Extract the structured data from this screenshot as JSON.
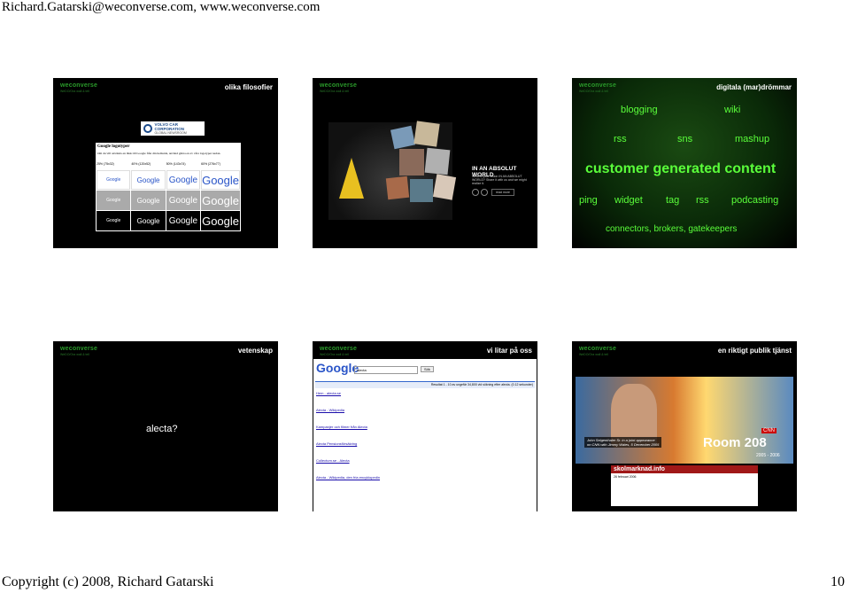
{
  "header": {
    "text": "Richard.Gatarski@weconverse.com, www.weconverse.com"
  },
  "footer": {
    "copyright": "Copyright (c) 2008, Richard Gatarski",
    "page_number": "10"
  },
  "brand": {
    "logo": "weconverse",
    "tagline": "WeDO/Ora wall & tell"
  },
  "slides": [
    {
      "title": "olika filosofier",
      "volvo_logo": "VOLVO CAR CORPORATION",
      "volvo_sub": "GLOBAL NEWSROOM",
      "google_heading": "Google logotyper",
      "google_text": "Om du vill använda en länk till Google från din hemsida, använd gärna en av våra logotyper nedan.",
      "sizes": [
        "25% (75x32)",
        "40% (120x52)",
        "50% (143x74)",
        "60% (276x77)"
      ],
      "google_word": "Google"
    },
    {
      "title": "",
      "headline": "IN AN ABSOLUT WORLD",
      "question": "What is your vision IN AN ABSOLUT WORLD? Share it with us and we might realize it.",
      "button": "read more"
    },
    {
      "title": "digitala (mar)drömmar",
      "words": [
        "blogging",
        "wiki",
        "rss",
        "sns",
        "mashup"
      ],
      "headline": "customer generated content",
      "row": [
        "ping",
        "widget",
        "tag",
        "rss",
        "podcasting"
      ],
      "bottom": "connectors, brokers, gatekeepers"
    },
    {
      "title": "vetenskap",
      "body": "alecta?"
    },
    {
      "title": "vi litar på oss",
      "google_word": "Google",
      "query": "alecta",
      "search_btn": "Sök",
      "results_header": "Resultat 1 - 10 av ungefär 34,800 vid sökning efter alecta. (0.12 sekunder)",
      "result_titles": [
        "Hem - alecta.se",
        "Alecta - Wikipedia",
        "Kampanjer och filmer från Alecta",
        "Alecta Pensionsförsäkring",
        "Collectum.se - Alecta",
        "Alecta - Wikipedia, den fria encyklopedin"
      ]
    },
    {
      "title": "en riktigt publik tjänst",
      "caption_name": "John Seigenthaler Sr. in a joint appearance",
      "caption_sub": "on CNN with Jimmy Wales, 5 December 2005",
      "cnn": "CNN",
      "show": "Room 208",
      "show_years": "2005 - 2006",
      "site": "skolmarknad.info",
      "news_date": "26 februari 2006"
    }
  ]
}
